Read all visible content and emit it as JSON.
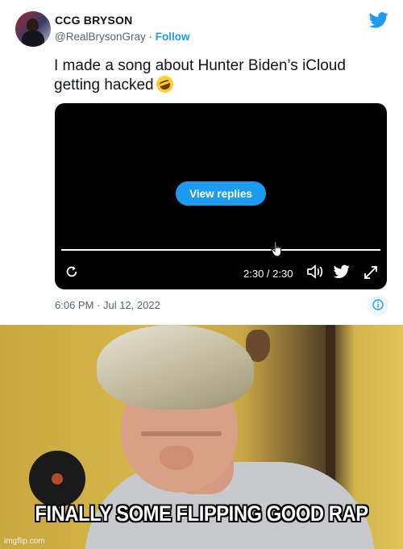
{
  "tweet": {
    "display_name": "CCG BRYSON",
    "handle": "@RealBrysonGray",
    "separator": " · ",
    "follow_label": "Follow",
    "text": "I made a song about Hunter Biden’s iCloud getting hacked",
    "emoji": "rolling-on-floor-laughing-emoji",
    "timestamp": "6:06 PM · Jul 12, 2022",
    "brand_color": "#1d9bf0"
  },
  "video": {
    "view_replies_label": "View replies",
    "time_display": "2:30 / 2:30",
    "progress": 1.0,
    "icons": [
      "replay-icon",
      "volume-icon",
      "twitter-bird-icon",
      "fullscreen-icon"
    ]
  },
  "meme": {
    "caption": "FINALLY SOME FLIPPING GOOD RAP",
    "watermark": "imgflip.com"
  }
}
